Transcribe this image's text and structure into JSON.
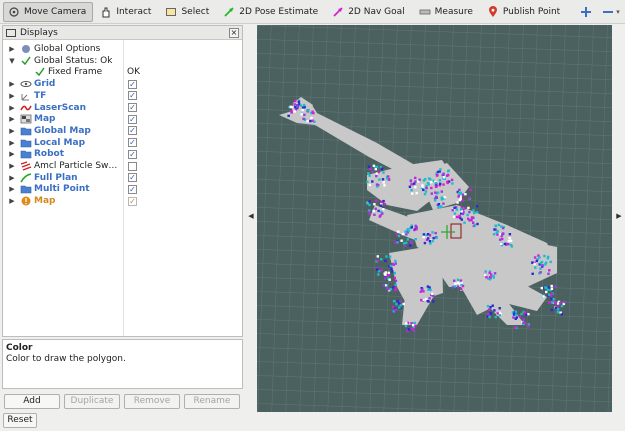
{
  "toolbar": {
    "tools": [
      {
        "name": "move-camera-button",
        "icon": "move-camera-icon",
        "label": "Move Camera",
        "active": true
      },
      {
        "name": "interact-button",
        "icon": "interact-icon",
        "label": "Interact",
        "active": false
      },
      {
        "name": "select-button",
        "icon": "select-icon",
        "label": "Select",
        "active": false
      },
      {
        "name": "2d-pose-estimate-button",
        "icon": "pose-estimate-icon",
        "label": "2D Pose Estimate",
        "active": false
      },
      {
        "name": "2d-nav-goal-button",
        "icon": "nav-goal-icon",
        "label": "2D Nav Goal",
        "active": false
      },
      {
        "name": "measure-button",
        "icon": "measure-icon",
        "label": "Measure",
        "active": false
      },
      {
        "name": "publish-point-button",
        "icon": "publish-point-icon",
        "label": "Publish Point",
        "active": false
      }
    ],
    "extra_icons": [
      "add-tool-icon",
      "remove-tool-icon",
      "view-options-icon"
    ]
  },
  "displays": {
    "title": "Displays",
    "items": [
      {
        "name": "display-global-options",
        "label": "Global Options",
        "icon": "globe-icon",
        "style": "normal",
        "value": "",
        "checkbox": null
      },
      {
        "name": "display-global-status",
        "label": "Global Status: Ok",
        "icon": "checkmark-icon",
        "style": "normal",
        "value": "",
        "checkbox": null,
        "expanded": true
      },
      {
        "name": "display-fixed-frame",
        "label": "Fixed Frame",
        "icon": "checkmark-icon",
        "style": "normal",
        "value": "OK",
        "checkbox": null,
        "child": true
      },
      {
        "name": "display-grid",
        "label": "Grid",
        "icon": "grid-icon",
        "style": "blue",
        "value": "",
        "checkbox": true
      },
      {
        "name": "display-tf",
        "label": "TF",
        "icon": "tf-icon",
        "style": "blue",
        "value": "",
        "checkbox": true
      },
      {
        "name": "display-laserscan",
        "label": "LaserScan",
        "icon": "laserscan-icon",
        "style": "blue",
        "value": "",
        "checkbox": true
      },
      {
        "name": "display-map",
        "label": "Map",
        "icon": "map-icon",
        "style": "blue",
        "value": "",
        "checkbox": true
      },
      {
        "name": "display-global-map",
        "label": "Global Map",
        "icon": "folder-icon",
        "style": "blue",
        "value": "",
        "checkbox": true
      },
      {
        "name": "display-local-map",
        "label": "Local Map",
        "icon": "folder-icon",
        "style": "blue",
        "value": "",
        "checkbox": true
      },
      {
        "name": "display-robot",
        "label": "Robot",
        "icon": "folder-icon",
        "style": "blue",
        "value": "",
        "checkbox": true
      },
      {
        "name": "display-amcl-particle-swarm",
        "label": "Amcl Particle Sw…",
        "icon": "particle-swarm-icon",
        "style": "normal",
        "value": "",
        "checkbox": false
      },
      {
        "name": "display-full-plan",
        "label": "Full Plan",
        "icon": "path-icon",
        "style": "blue",
        "value": "",
        "checkbox": true
      },
      {
        "name": "display-multi-point",
        "label": "Multi Point",
        "icon": "folder-icon",
        "style": "blue",
        "value": "",
        "checkbox": true
      },
      {
        "name": "display-map-warning",
        "label": "Map",
        "icon": "warning-icon",
        "style": "orange",
        "value": "",
        "checkbox": "partial"
      }
    ]
  },
  "description": {
    "title": "Color",
    "body": "Color to draw the polygon."
  },
  "buttons": {
    "add": "Add",
    "duplicate": "Duplicate",
    "remove": "Remove",
    "rename": "Rename",
    "reset": "Reset"
  },
  "colors": {
    "grid_background": "#4a6160",
    "free_space": "#c8c8c8",
    "obstacle_magenta": "#d21fd8",
    "obstacle_blue": "#2a2ad0",
    "obstacle_cyan": "#19c0c0",
    "link_blue": "#3a6fc2"
  }
}
